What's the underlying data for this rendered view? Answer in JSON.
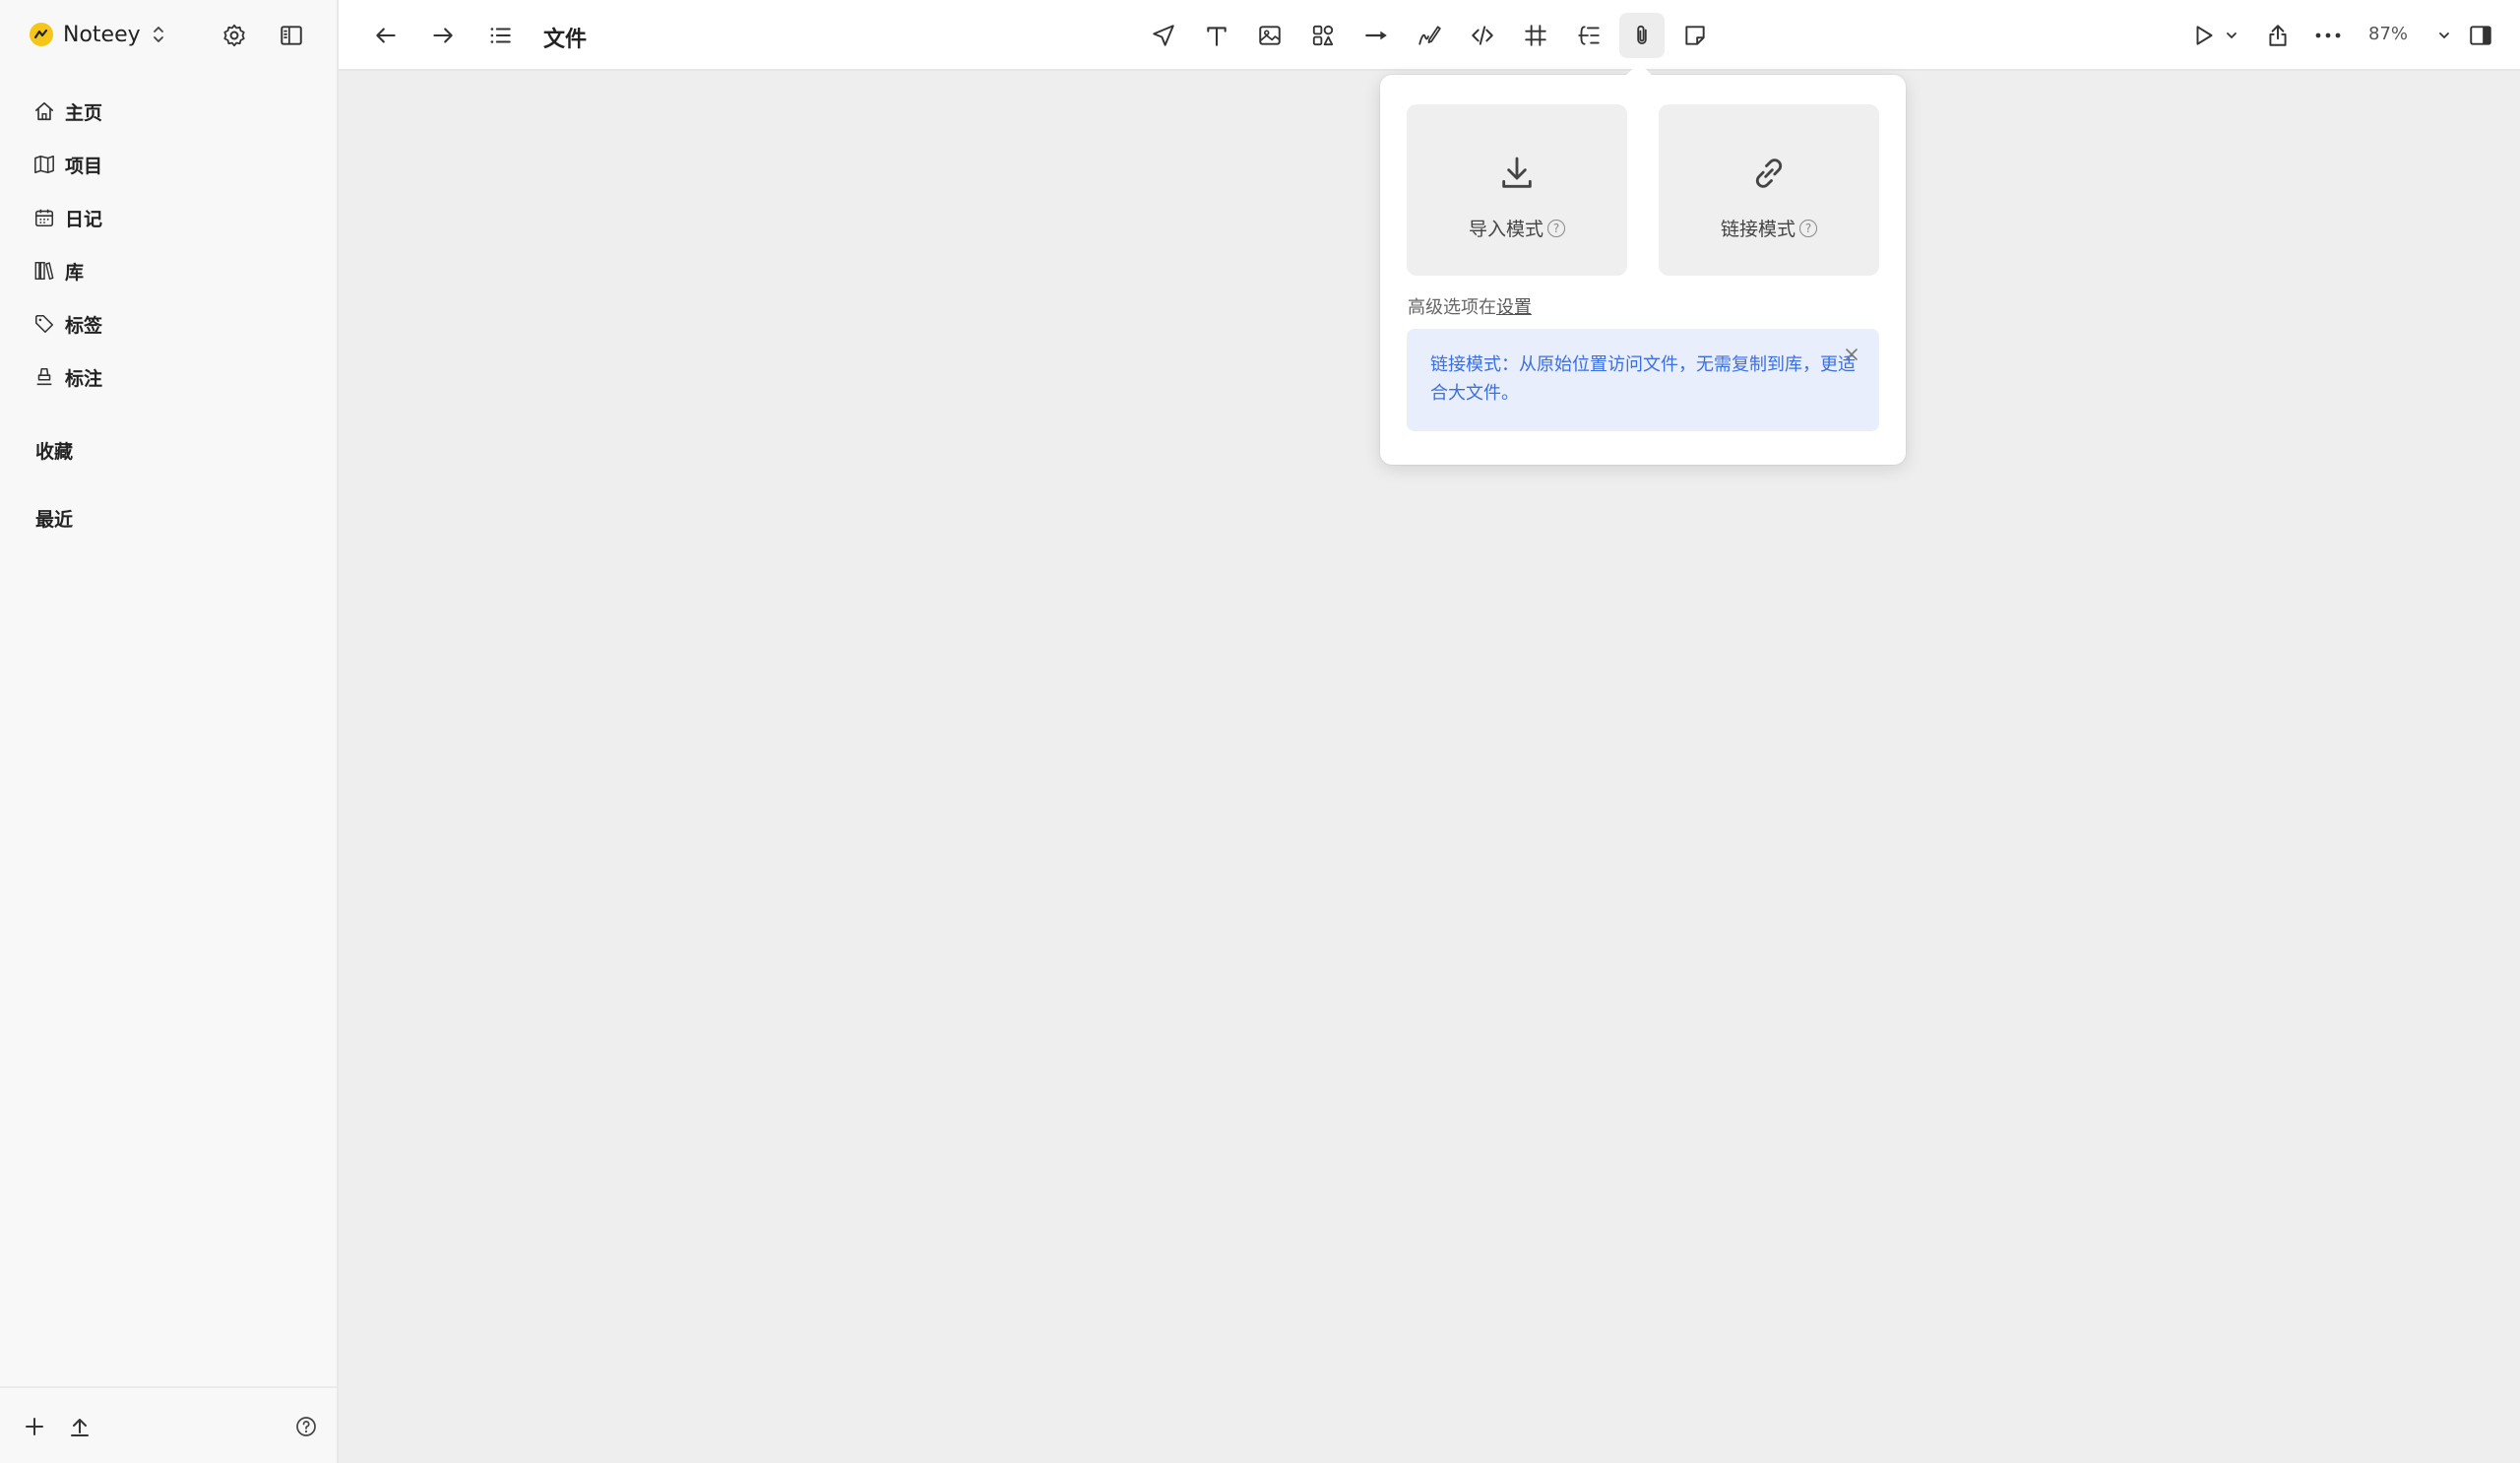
{
  "workspace": {
    "name": "Noteey"
  },
  "sidebar": {
    "items": [
      {
        "label": "主页",
        "icon": "home-icon"
      },
      {
        "label": "项目",
        "icon": "book-icon"
      },
      {
        "label": "日记",
        "icon": "calendar-icon"
      },
      {
        "label": "库",
        "icon": "library-icon"
      },
      {
        "label": "标签",
        "icon": "tag-icon"
      },
      {
        "label": "标注",
        "icon": "highlighter-icon"
      }
    ],
    "sections": {
      "favorites": "收藏",
      "recent": "最近"
    }
  },
  "document": {
    "title": "文件"
  },
  "toolbar": {
    "zoom": "87%",
    "active_tool": "attachment"
  },
  "popover": {
    "import_mode": "导入模式",
    "link_mode": "链接模式",
    "help_glyph": "?",
    "advanced_prefix": "高级选项在",
    "advanced_link": "设置",
    "info": "链接模式：从原始位置访问文件，无需复制到库，更适合大文件。"
  },
  "colors": {
    "accent_blue": "#3b6fe0",
    "info_bg": "#e8eefc",
    "logo_yellow": "#f5c518"
  }
}
